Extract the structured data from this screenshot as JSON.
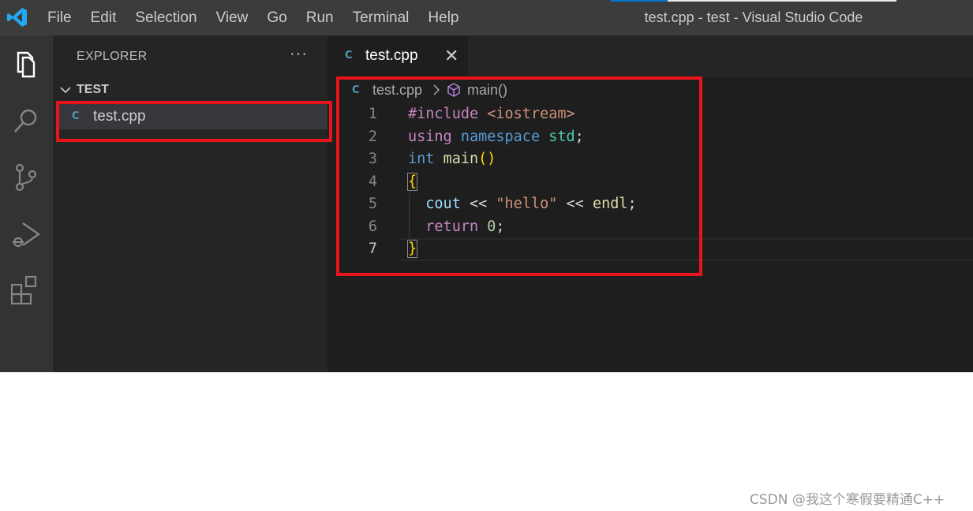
{
  "titlebar": {
    "menu": [
      "File",
      "Edit",
      "Selection",
      "View",
      "Go",
      "Run",
      "Terminal",
      "Help"
    ],
    "window_title": "test.cpp - test - Visual Studio Code",
    "accent_color": "#0078d4"
  },
  "activitybar": {
    "icons": [
      "files-icon",
      "search-icon",
      "source-control-icon",
      "run-debug-icon",
      "extensions-icon"
    ]
  },
  "sidebar": {
    "title": "EXPLORER",
    "more_actions": "···",
    "folder": "TEST",
    "files": [
      {
        "name": "test.cpp",
        "icon": "C"
      }
    ]
  },
  "editor": {
    "tab": {
      "label": "test.cpp",
      "icon": "C",
      "close": "✕"
    },
    "breadcrumb": {
      "file": "test.cpp",
      "symbol": "main()"
    },
    "line_numbers": [
      "1",
      "2",
      "3",
      "4",
      "5",
      "6",
      "7"
    ],
    "active_line": "7",
    "code": {
      "l1": {
        "directive": "#include",
        "header": "<iostream>"
      },
      "l2": {
        "kw_using": "using",
        "kw_namespace": "namespace",
        "ns": "std",
        "semi": ";"
      },
      "l3": {
        "type": "int",
        "fn": "main",
        "parens": "()"
      },
      "l4": {
        "brace": "{"
      },
      "l5": {
        "var": "cout",
        "op1": "<<",
        "str": "\"hello\"",
        "op2": "<<",
        "fn": "endl",
        "semi": ";"
      },
      "l6": {
        "kw": "return",
        "num": "0",
        "semi": ";"
      },
      "l7": {
        "brace": "}"
      }
    }
  },
  "annotations": {
    "highlight_color": "#e8141c"
  },
  "watermark": "CSDN @我这个寒假要精通C++"
}
